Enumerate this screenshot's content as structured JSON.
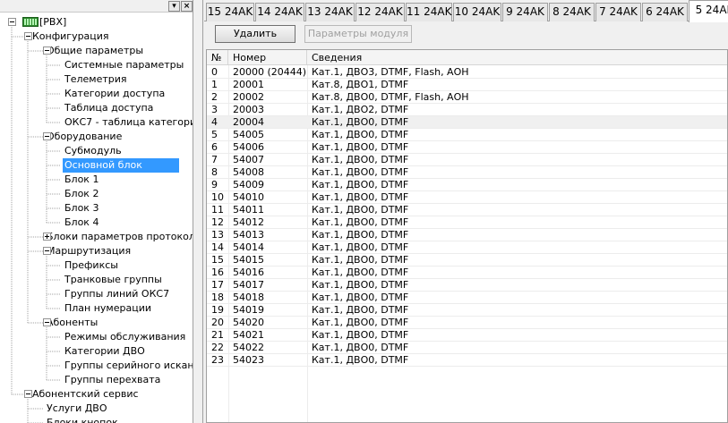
{
  "window": {
    "pin_glyph": "▾",
    "close_glyph": "×"
  },
  "tree": [
    {
      "label": "[PBX]",
      "level": 0,
      "expander": "minus",
      "icon": "pbx-icon"
    },
    {
      "label": "Конфигурация",
      "level": 1,
      "expander": "minus"
    },
    {
      "label": "Общие параметры",
      "level": 2,
      "expander": "minus"
    },
    {
      "label": "Системные параметры",
      "level": 3
    },
    {
      "label": "Телеметрия",
      "level": 3
    },
    {
      "label": "Категории доступа",
      "level": 3
    },
    {
      "label": "Таблица доступа",
      "level": 3
    },
    {
      "label": "ОКС7 - таблица категори",
      "level": 3
    },
    {
      "label": "Оборудование",
      "level": 2,
      "expander": "minus"
    },
    {
      "label": "Субмодуль",
      "level": 3
    },
    {
      "label": "Основной блок",
      "level": 3,
      "selected": true
    },
    {
      "label": "Блок 1",
      "level": 3
    },
    {
      "label": "Блок 2",
      "level": 3
    },
    {
      "label": "Блок 3",
      "level": 3
    },
    {
      "label": "Блок 4",
      "level": 3
    },
    {
      "label": "Блоки параметров протокол",
      "level": 2,
      "expander": "plus"
    },
    {
      "label": "Маршрутизация",
      "level": 2,
      "expander": "minus"
    },
    {
      "label": "Префиксы",
      "level": 3
    },
    {
      "label": "Транковые группы",
      "level": 3
    },
    {
      "label": "Группы линий ОКС7",
      "level": 3
    },
    {
      "label": "План нумерации",
      "level": 3
    },
    {
      "label": "Абоненты",
      "level": 2,
      "expander": "minus"
    },
    {
      "label": "Режимы обслуживания",
      "level": 3
    },
    {
      "label": "Категории ДВО",
      "level": 3
    },
    {
      "label": "Группы серийного искан",
      "level": 3
    },
    {
      "label": "Группы перехвата",
      "level": 3
    },
    {
      "label": "Абонентский сервис",
      "level": 1,
      "expander": "minus"
    },
    {
      "label": "Услуги ДВО",
      "level": 2
    },
    {
      "label": "Блоки кнопок",
      "level": 2
    }
  ],
  "tabs": [
    {
      "label": "15  24AK",
      "w": 54
    },
    {
      "label": "14  24AK",
      "w": 55
    },
    {
      "label": "13  24AK",
      "w": 55
    },
    {
      "label": "12  24AK",
      "w": 55
    },
    {
      "label": "11  24AK",
      "w": 52
    },
    {
      "label": "10  24AK",
      "w": 54
    },
    {
      "label": "9  24AK",
      "w": 51
    },
    {
      "label": "8  24AK",
      "w": 51
    },
    {
      "label": "7  24AK",
      "w": 51
    },
    {
      "label": "6  24AK",
      "w": 51
    },
    {
      "label": "5  24AK",
      "w": 58,
      "active": true
    }
  ],
  "toolbar": {
    "delete_label": "Удалить",
    "module_params_label": "Параметры модуля"
  },
  "table": {
    "columns": [
      "№",
      "Номер",
      "Сведения"
    ],
    "highlighted_row": 4,
    "rows": [
      [
        "0",
        "20000 (20444)",
        "Кат.1, ДВО3, DTMF, Flash, АОН"
      ],
      [
        "1",
        "20001",
        "Кат.8, ДВО1, DTMF"
      ],
      [
        "2",
        "20002",
        "Кат.8, ДВО0, DTMF, Flash, АОН"
      ],
      [
        "3",
        "20003",
        "Кат.1, ДВО2, DTMF"
      ],
      [
        "4",
        "20004",
        "Кат.1, ДВО0, DTMF"
      ],
      [
        "5",
        "54005",
        "Кат.1, ДВО0, DTMF"
      ],
      [
        "6",
        "54006",
        "Кат.1, ДВО0, DTMF"
      ],
      [
        "7",
        "54007",
        "Кат.1, ДВО0, DTMF"
      ],
      [
        "8",
        "54008",
        "Кат.1, ДВО0, DTMF"
      ],
      [
        "9",
        "54009",
        "Кат.1, ДВО0, DTMF"
      ],
      [
        "10",
        "54010",
        "Кат.1, ДВО0, DTMF"
      ],
      [
        "11",
        "54011",
        "Кат.1, ДВО0, DTMF"
      ],
      [
        "12",
        "54012",
        "Кат.1, ДВО0, DTMF"
      ],
      [
        "13",
        "54013",
        "Кат.1, ДВО0, DTMF"
      ],
      [
        "14",
        "54014",
        "Кат.1, ДВО0, DTMF"
      ],
      [
        "15",
        "54015",
        "Кат.1, ДВО0, DTMF"
      ],
      [
        "16",
        "54016",
        "Кат.1, ДВО0, DTMF"
      ],
      [
        "17",
        "54017",
        "Кат.1, ДВО0, DTMF"
      ],
      [
        "18",
        "54018",
        "Кат.1, ДВО0, DTMF"
      ],
      [
        "19",
        "54019",
        "Кат.1, ДВО0, DTMF"
      ],
      [
        "20",
        "54020",
        "Кат.1, ДВО0, DTMF"
      ],
      [
        "21",
        "54021",
        "Кат.1, ДВО0, DTMF"
      ],
      [
        "22",
        "54022",
        "Кат.1, ДВО0, DTMF"
      ],
      [
        "23",
        "54023",
        "Кат.1, ДВО0, DTMF"
      ]
    ]
  },
  "colors": {
    "selection": "#3399ff",
    "root_icon": "#2e8b2e"
  }
}
